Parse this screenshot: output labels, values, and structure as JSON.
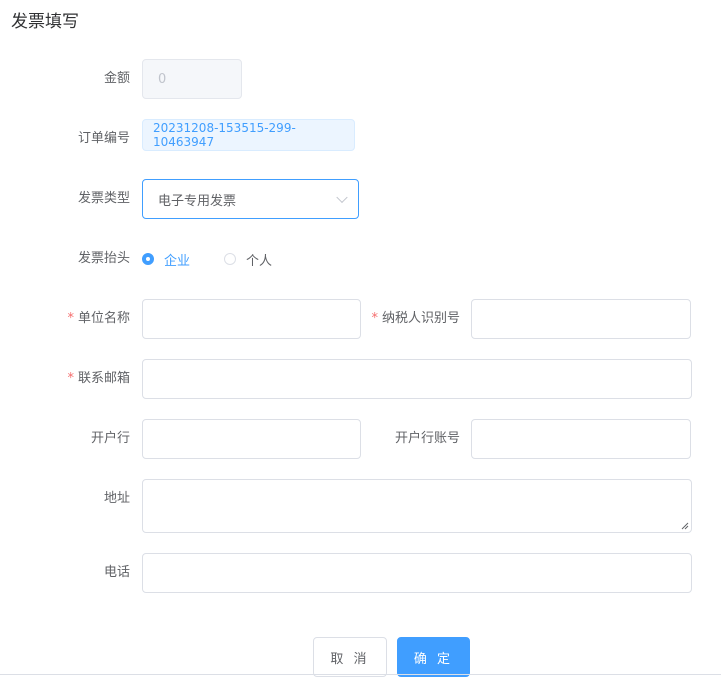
{
  "page": {
    "title": "发票填写"
  },
  "form": {
    "amount": {
      "label": "金额",
      "value": "0"
    },
    "order_no": {
      "label": "订单编号",
      "value": "20231208-153515-299-10463947"
    },
    "invoice_type": {
      "label": "发票类型",
      "value": "电子专用发票"
    },
    "invoice_header": {
      "label": "发票抬头",
      "options": [
        "企业",
        "个人"
      ],
      "selected": "企业"
    },
    "company_name": {
      "label": "单位名称",
      "required": true,
      "value": ""
    },
    "tax_id": {
      "label": "纳税人识别号",
      "required": true,
      "value": ""
    },
    "email": {
      "label": "联系邮箱",
      "required": true,
      "value": ""
    },
    "bank": {
      "label": "开户行",
      "value": ""
    },
    "bank_account": {
      "label": "开户行账号",
      "value": ""
    },
    "address": {
      "label": "地址",
      "value": ""
    },
    "phone": {
      "label": "电话",
      "value": ""
    }
  },
  "actions": {
    "cancel_label": "取 消",
    "confirm_label": "确 定"
  },
  "colors": {
    "primary": "#409eff",
    "required": "#f56c6c",
    "border": "#dcdfe6"
  }
}
